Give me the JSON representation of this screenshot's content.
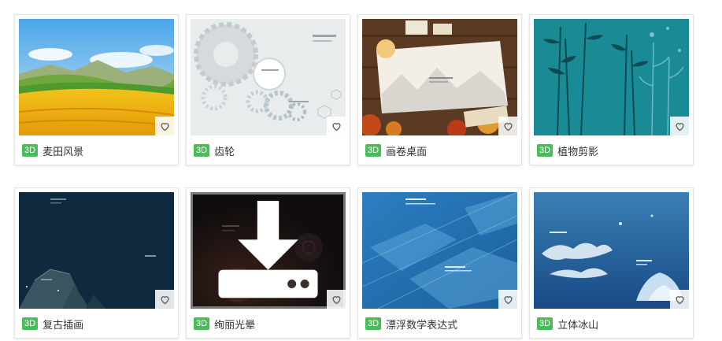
{
  "templates": [
    {
      "badge": "3D",
      "title": "麦田风景"
    },
    {
      "badge": "3D",
      "title": "齿轮"
    },
    {
      "badge": "3D",
      "title": "画卷桌面"
    },
    {
      "badge": "3D",
      "title": "植物剪影"
    },
    {
      "badge": "3D",
      "title": "复古插画"
    },
    {
      "badge": "3D",
      "title": "绚丽光晕"
    },
    {
      "badge": "3D",
      "title": "漂浮数学表达式"
    },
    {
      "badge": "3D",
      "title": "立体冰山"
    }
  ],
  "colors": {
    "badge_green": "#4cbc5a",
    "heart_icon": "#555555"
  },
  "icons": {
    "favorite": "heart-outline-icon",
    "download": "download-icon"
  }
}
